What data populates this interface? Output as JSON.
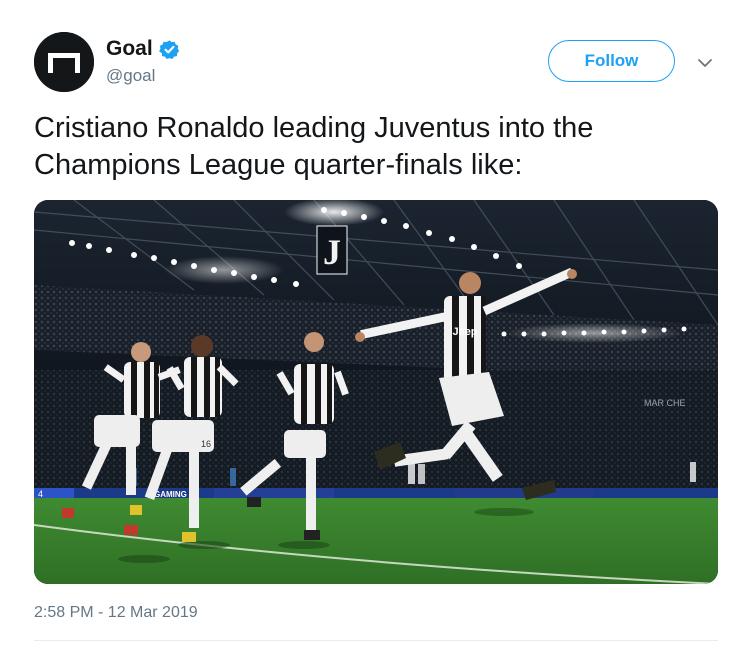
{
  "user": {
    "display_name": "Goal",
    "handle": "@goal",
    "avatar_icon": "goal-logo-icon",
    "verified_icon": "verified-badge-icon"
  },
  "actions": {
    "follow_label": "Follow",
    "menu_icon": "chevron-down-icon"
  },
  "tweet": {
    "text": "Cristiano Ronaldo leading Juventus into the Champions League quarter-finals like:",
    "timestamp": "2:58 PM - 12 Mar 2019"
  },
  "media": {
    "logo_text": "J",
    "sponsor_text": "Jeep",
    "board_text": "MAR CHE",
    "board_text_2": "GAMING",
    "board_number": "4",
    "shirt_number": "16"
  },
  "colors": {
    "twitter_blue": "#1da1f2",
    "secondary_text": "#657786",
    "primary_text": "#14171a",
    "pitch_green": "#3e8a2f"
  }
}
